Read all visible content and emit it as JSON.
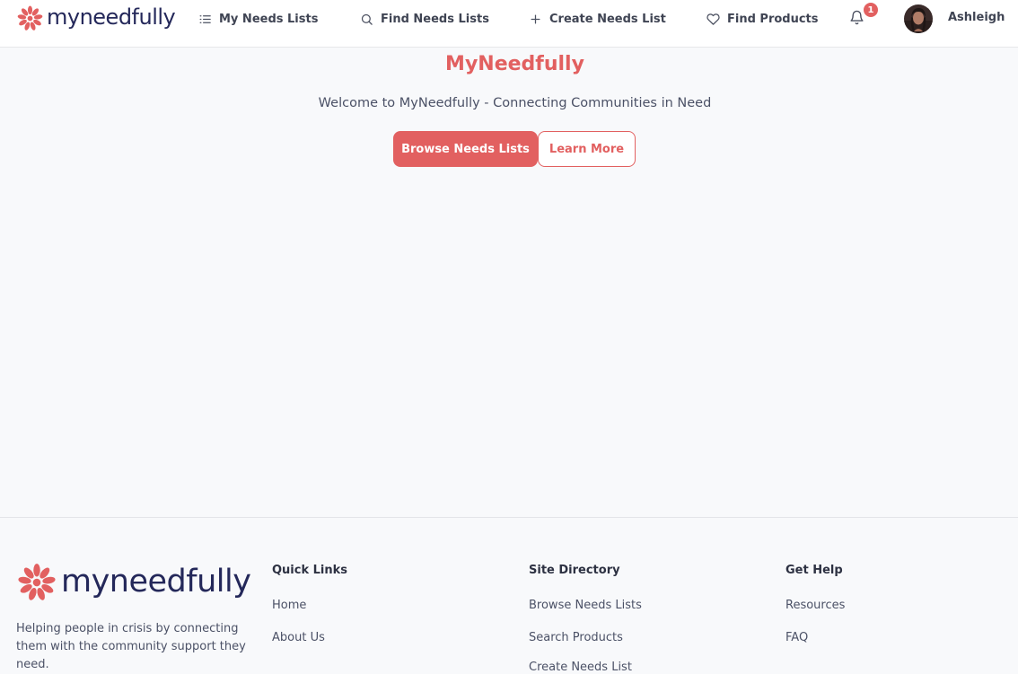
{
  "brand": {
    "logo_text": "myneedfully",
    "accent_color": "#e26060",
    "navy_color": "#24285a"
  },
  "nav": {
    "items": [
      {
        "label": "My Needs Lists",
        "icon": "list-icon"
      },
      {
        "label": "Find Needs Lists",
        "icon": "search-icon"
      },
      {
        "label": "Create Needs List",
        "icon": "plus-icon"
      },
      {
        "label": "Find Products",
        "icon": "heart-icon"
      }
    ],
    "notifications_count": "1",
    "user_name": "Ashleigh"
  },
  "hero": {
    "title": "MyNeedfully",
    "subtitle": "Welcome to MyNeedfully - Connecting Communities in Need",
    "primary_button": "Browse Needs Lists",
    "secondary_button": "Learn More"
  },
  "footer": {
    "logo_text": "myneedfully",
    "tagline": "Helping people in crisis by connecting them with the community support they need.",
    "columns": [
      {
        "title": "Quick Links",
        "links": [
          "Home",
          "About Us"
        ]
      },
      {
        "title": "Site Directory",
        "links": [
          "Browse Needs Lists",
          "Search Products",
          "Create Needs List"
        ]
      },
      {
        "title": "Get Help",
        "links": [
          "Resources",
          "FAQ"
        ]
      }
    ]
  }
}
